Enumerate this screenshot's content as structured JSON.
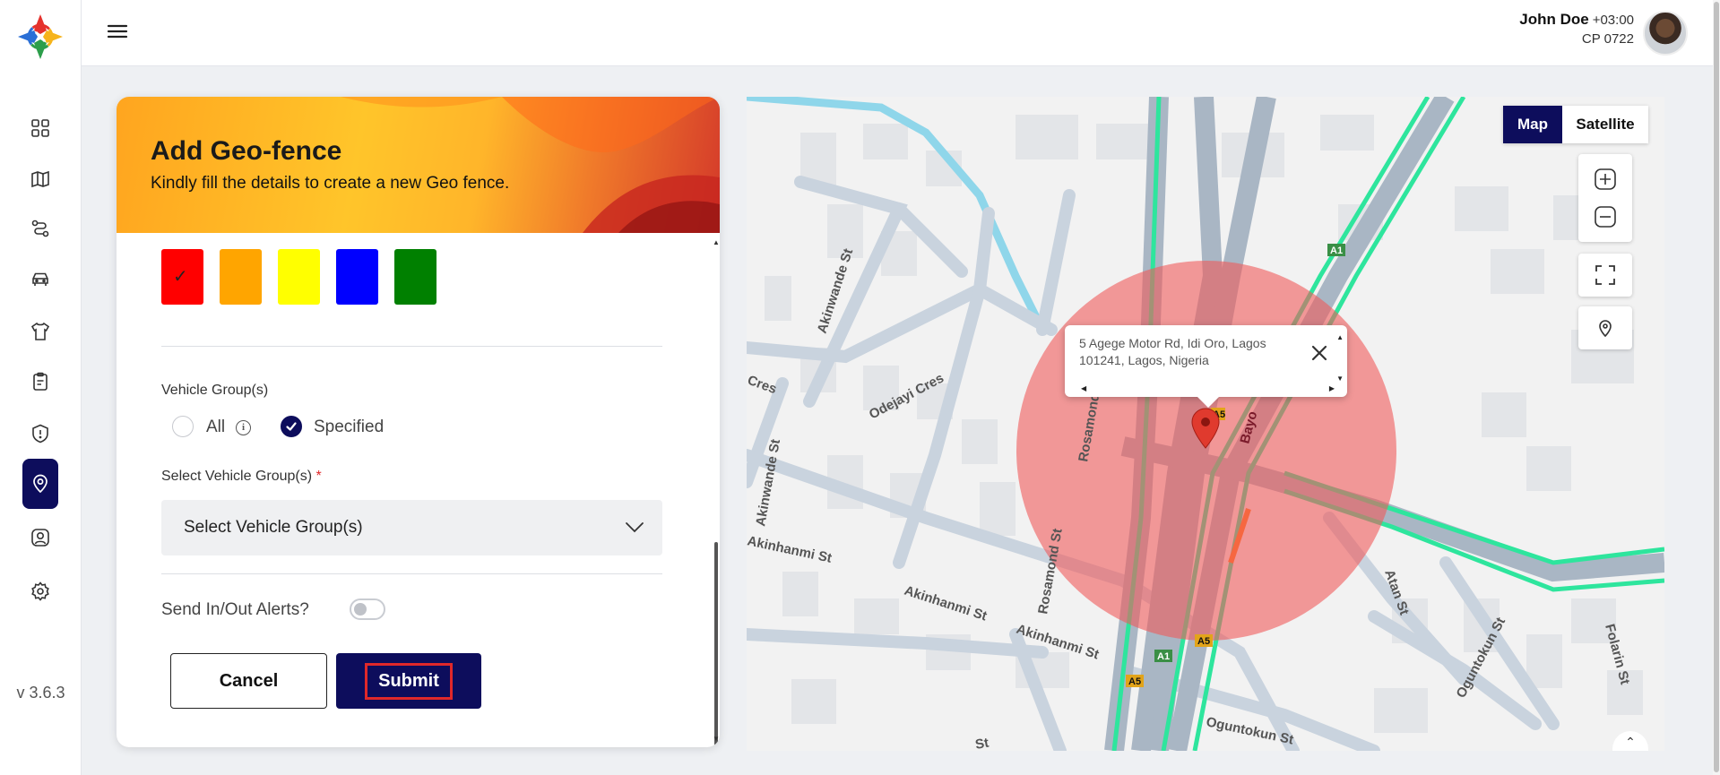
{
  "app": {
    "version": "v 3.6.3"
  },
  "header": {
    "user_name": "John Doe",
    "user_tz": "+03:00",
    "user_code": "CP 0722"
  },
  "sidebar": {
    "items": [
      {
        "icon": "dashboard-icon"
      },
      {
        "icon": "map-icon"
      },
      {
        "icon": "route-icon"
      },
      {
        "icon": "car-icon"
      },
      {
        "icon": "shirt-icon"
      },
      {
        "icon": "clipboard-icon"
      },
      {
        "icon": "alert-icon"
      },
      {
        "icon": "geofence-icon",
        "active": true
      },
      {
        "icon": "user-icon"
      },
      {
        "icon": "gear-icon"
      }
    ]
  },
  "form": {
    "title": "Add Geo-fence",
    "subtitle": "Kindly fill the details to create a new Geo fence.",
    "colors": [
      {
        "hex": "#ff0000",
        "selected": true
      },
      {
        "hex": "#ffa500",
        "selected": false
      },
      {
        "hex": "#ffff00",
        "selected": false
      },
      {
        "hex": "#0000ff",
        "selected": false
      },
      {
        "hex": "#008000",
        "selected": false
      }
    ],
    "check_glyph": "✓",
    "vehicle_groups_label": "Vehicle Group(s)",
    "radio_all": "All",
    "info_glyph": "i",
    "radio_specified": "Specified",
    "select_label": "Select Vehicle Group(s)",
    "required_mark": "*",
    "select_placeholder": "Select Vehicle Group(s)",
    "alerts_label": "Send In/Out Alerts?",
    "cancel_label": "Cancel",
    "submit_label": "Submit"
  },
  "map": {
    "type_map": "Map",
    "type_satellite": "Satellite",
    "info_address": "5 Agege Motor Rd, Idi Oro, Lagos 101241, Lagos, Nigeria",
    "street_labels": [
      "Akinwande St",
      "Odejayi Cres",
      "Akinwande St",
      "Akinhanmi St",
      "Akinhanmi St",
      "Akinhanmi St",
      "Rosamond St",
      "Rosamond St",
      "Bayo",
      "Atan St",
      "Oguntokun St",
      "Folarin St",
      "Oguntokun St",
      "Cres",
      "St",
      "A1",
      "A1",
      "A5",
      "A5",
      "A5"
    ],
    "colors": {
      "highway": "#2ee59d",
      "geofence": "#f05a5a",
      "road": "#c5cfda"
    }
  },
  "scroll_glyphs": {
    "up": "▲",
    "down": "▼",
    "left": "◀",
    "right": "▶",
    "chevron_up": "⌃"
  }
}
